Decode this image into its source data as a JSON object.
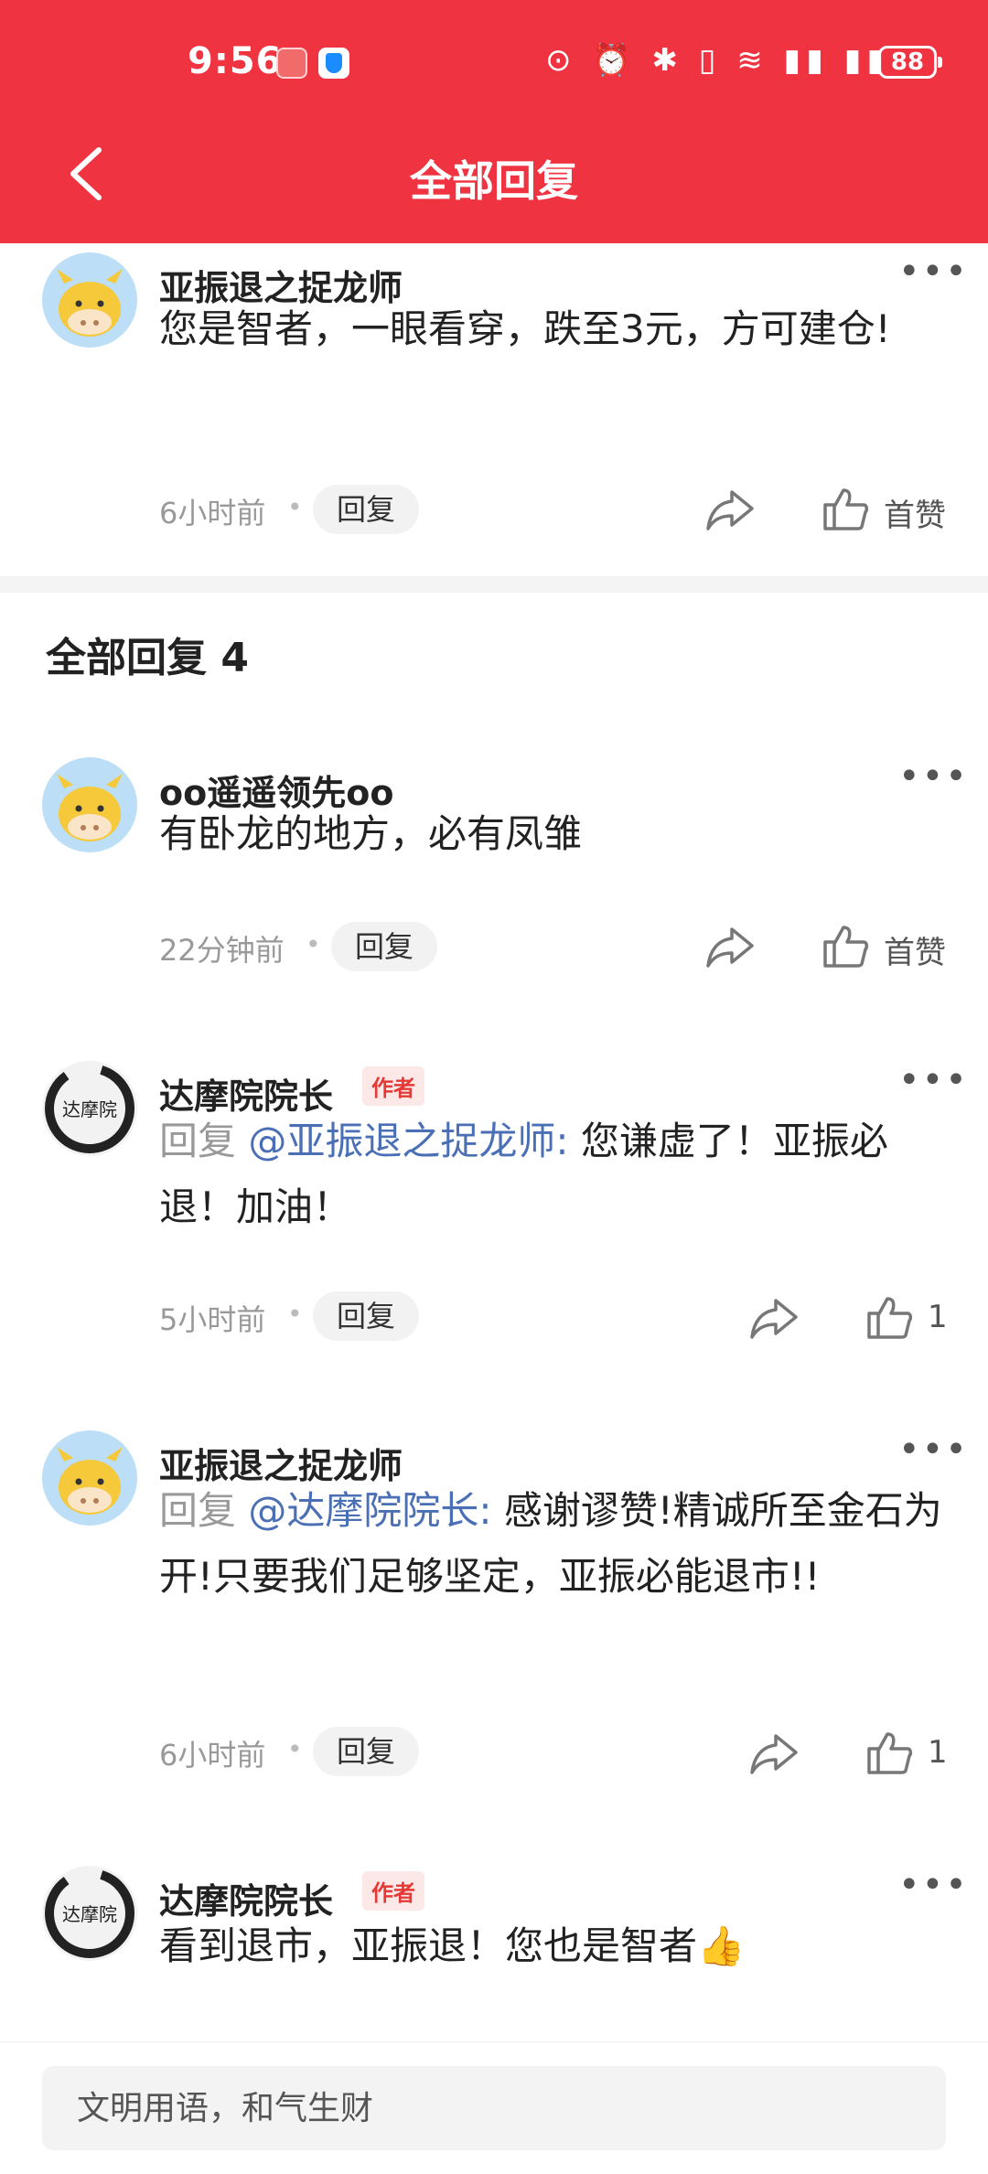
{
  "status_bar": {
    "time": "9:56",
    "battery": "88"
  },
  "header": {
    "title": "全部回复"
  },
  "main_comment": {
    "user": "亚振退之捉龙师",
    "text": "您是智者，一眼看穿，跌至3元，方可建仓!",
    "time": "6小时前",
    "reply_label": "回复",
    "like_label": "首赞"
  },
  "replies_section": {
    "title": "全部回复 4"
  },
  "replies": [
    {
      "user": "oo遥遥领先oo",
      "text": "有卧龙的地方，必有凤雏",
      "time": "22分钟前",
      "reply_label": "回复",
      "like_label": "首赞"
    },
    {
      "user": "达摩院院长",
      "tag": "作者",
      "reply_prefix": "回复 ",
      "mention": "@亚振退之捉龙师:",
      "text": "  您谦虚了！亚振必退！加油！",
      "time": "5小时前",
      "reply_label": "回复",
      "like_count": "1"
    },
    {
      "user": "亚振退之捉龙师",
      "reply_prefix": "回复 ",
      "mention": "@达摩院院长:",
      "text": "  感谢谬赞!精诚所至金石为开!只要我们足够坚定，亚振必能退市!!",
      "time": "6小时前",
      "reply_label": "回复",
      "like_count": "1"
    },
    {
      "user": "达摩院院长",
      "tag": "作者",
      "text": "看到退市，亚振退！您也是智者👍"
    }
  ],
  "input": {
    "placeholder": "文明用语，和气生财"
  },
  "colors": {
    "brand": "#EF3340",
    "mention": "#4a6fb5",
    "author_tag": "#e53935"
  },
  "icons": [
    "back-chevron-icon",
    "more-dots-icon",
    "share-arrow-icon",
    "thumbs-up-icon",
    "wifi-icon",
    "signal-icon",
    "battery-icon"
  ]
}
